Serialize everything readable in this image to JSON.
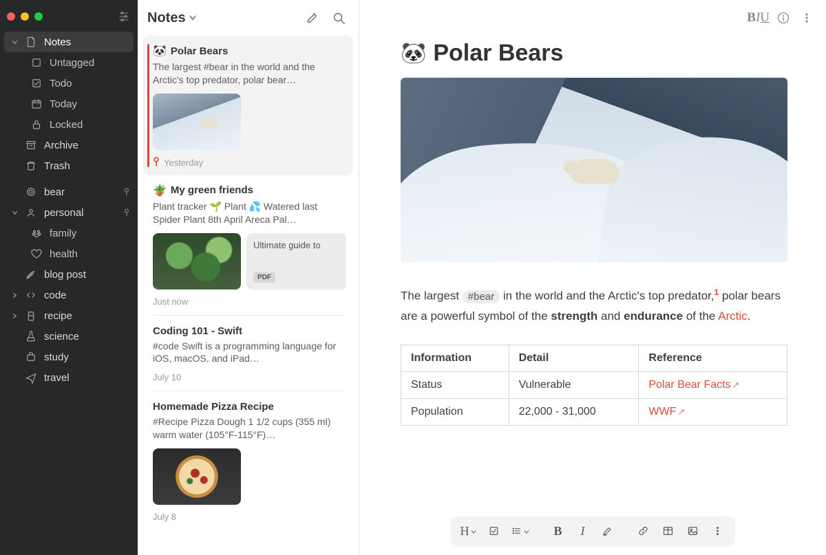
{
  "sidebar": {
    "top_items": [
      {
        "label": "Notes",
        "icon": "note",
        "active": true,
        "has_caret": true,
        "caret": "down"
      },
      {
        "label": "Untagged",
        "icon": "checkbox",
        "sub": true
      },
      {
        "label": "Todo",
        "icon": "checkbox",
        "sub": true
      },
      {
        "label": "Today",
        "icon": "calendar",
        "sub": true
      },
      {
        "label": "Locked",
        "icon": "lock",
        "sub": true
      },
      {
        "label": "Archive",
        "icon": "archive"
      },
      {
        "label": "Trash",
        "icon": "trash"
      }
    ],
    "tags": [
      {
        "label": "bear",
        "icon": "circle",
        "pinned": true
      },
      {
        "label": "personal",
        "icon": "profile",
        "pinned": true,
        "has_caret": true,
        "caret": "down"
      },
      {
        "label": "family",
        "icon": "paw",
        "sub": true
      },
      {
        "label": "health",
        "icon": "heart",
        "sub": true
      },
      {
        "label": "blog post",
        "icon": "feather",
        "has_caret": false
      },
      {
        "label": "code",
        "icon": "code",
        "has_caret": true,
        "caret": "right"
      },
      {
        "label": "recipe",
        "icon": "jar",
        "has_caret": true,
        "caret": "right"
      },
      {
        "label": "science",
        "icon": "flask"
      },
      {
        "label": "study",
        "icon": "bag"
      },
      {
        "label": "travel",
        "icon": "plane"
      }
    ]
  },
  "notelist": {
    "title": "Notes",
    "items": [
      {
        "emoji": "🐼",
        "title": "Polar Bears",
        "preview": "The largest #bear in the world and the Arctic's top predator, polar bear…",
        "meta": "Yesterday",
        "pinned": true,
        "selected": true,
        "thumb": "polar"
      },
      {
        "emoji": "🪴",
        "title": "My green friends",
        "preview": "Plant tracker 🌱 Plant 💦 Watered last Spider Plant 8th April Areca Pal…",
        "meta": "Just now",
        "thumb": "plants",
        "attachment": {
          "title": "Ultimate guide to",
          "badge": "PDF"
        }
      },
      {
        "title": "Coding 101 - Swift",
        "preview": "#code Swift is a programming language for iOS, macOS, and iPad…",
        "meta": "July 10"
      },
      {
        "title": "Homemade Pizza Recipe",
        "preview": "#Recipe Pizza Dough 1 1/2 cups (355 ml) warm water (105°F-115°F)…",
        "meta": "July 8",
        "thumb": "pizza"
      }
    ]
  },
  "editor": {
    "title_emoji": "🐼",
    "title": "Polar Bears",
    "para": {
      "p1a": "The largest ",
      "hashtag": "#bear",
      "p1b": " in the world and the Arctic's top predator,",
      "sup": "1",
      "p2a": " polar bears are a powerful symbol of the ",
      "strong1": "strength",
      "p2b": " and ",
      "strong2": "endurance",
      "p3a": " of the ",
      "link_arctic": "Arctic",
      "p3b": "."
    },
    "table": {
      "headers": [
        "Information",
        "Detail",
        "Reference"
      ],
      "rows": [
        {
          "info": "Status",
          "detail": "Vulnerable",
          "ref": "Polar Bear Facts"
        },
        {
          "info": "Population",
          "detail": "22,000 - 31,000",
          "ref": "WWF"
        }
      ]
    },
    "toolbar": {
      "heading": "H",
      "bold": "B",
      "italic": "I"
    }
  }
}
